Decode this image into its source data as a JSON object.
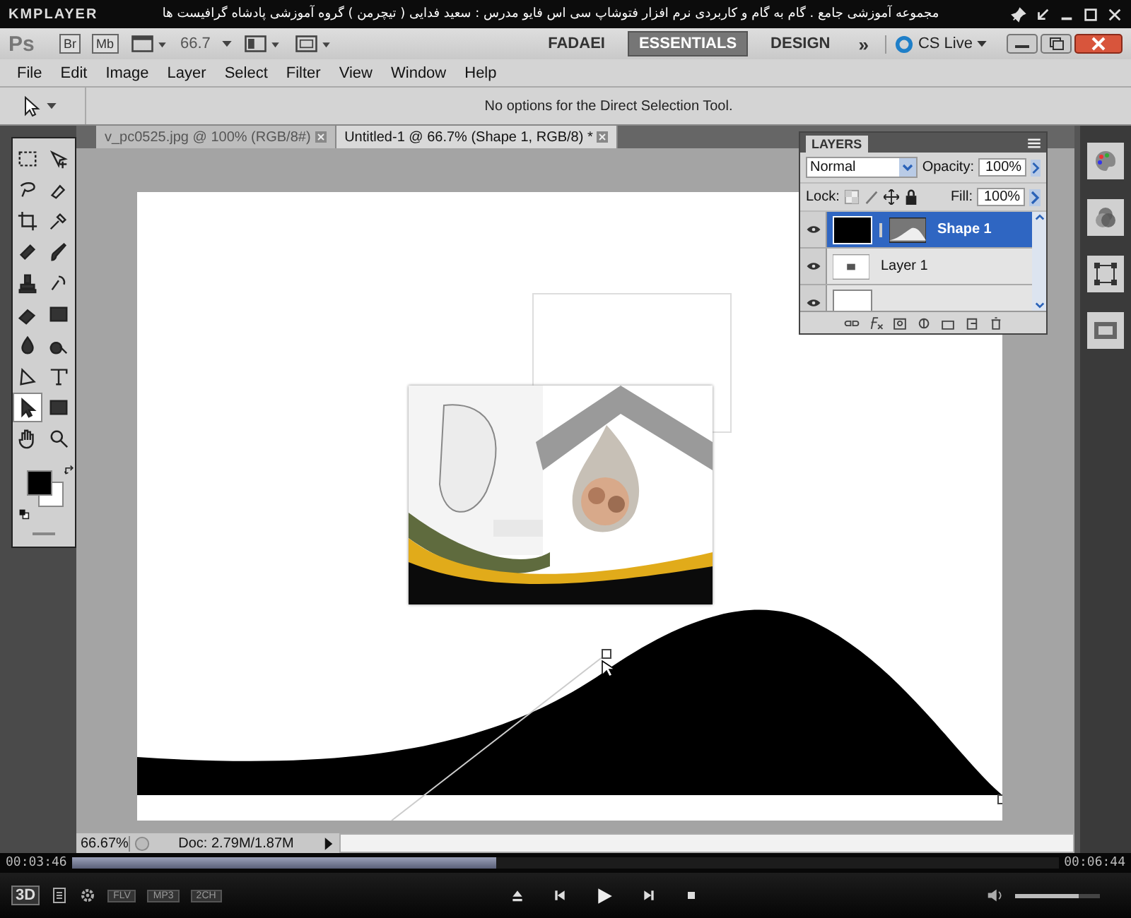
{
  "player": {
    "logo": "KMPLAYER",
    "title": "مجموعه آموزشی جامع . گام به گام و کاربردی نرم افزار فتوشاپ سی اس فایو  مدرس : سعید فدایی ( تیچرمن ) گروه آموزشی پادشاه گرافیست ها"
  },
  "app_bar": {
    "logo": "Ps",
    "bridge": "Br",
    "mini_bridge": "Mb",
    "zoom": "66.7",
    "more": "»",
    "cs_live": "CS Live",
    "workspaces": [
      {
        "label": "FADAEI",
        "selected": false
      },
      {
        "label": "ESSENTIALS",
        "selected": true
      },
      {
        "label": "DESIGN",
        "selected": false
      }
    ]
  },
  "menu": [
    "File",
    "Edit",
    "Image",
    "Layer",
    "Select",
    "Filter",
    "View",
    "Window",
    "Help"
  ],
  "options_bar": {
    "message": "No options for the Direct Selection Tool."
  },
  "doc_tabs": [
    {
      "label": "v_pc0525.jpg @ 100% (RGB/8#)",
      "selected": false
    },
    {
      "label": "Untitled-1 @ 66.7% (Shape 1, RGB/8) *",
      "selected": true
    }
  ],
  "tools": [
    {
      "selected": false
    },
    {
      "selected": false
    },
    {
      "selected": false
    },
    {
      "selected": false
    },
    {
      "selected": false
    },
    {
      "selected": false
    },
    {
      "selected": false
    },
    {
      "selected": false
    },
    {
      "selected": false
    },
    {
      "selected": false
    },
    {
      "selected": false
    },
    {
      "selected": false
    },
    {
      "selected": false
    },
    {
      "selected": false
    },
    {
      "selected": false
    },
    {
      "selected": false
    },
    {
      "selected": true
    },
    {
      "selected": false
    },
    {
      "selected": false
    },
    {
      "selected": false
    }
  ],
  "layers_panel": {
    "title": "LAYERS",
    "blend_mode": "Normal",
    "opacity_label": "Opacity:",
    "opacity": "100%",
    "lock_label": "Lock:",
    "fill_label": "Fill:",
    "fill": "100%",
    "layers": [
      {
        "kind": "shape",
        "name": "Shape 1",
        "selected": true,
        "visible": true
      },
      {
        "kind": "pixel",
        "name": "Layer 1",
        "selected": false,
        "visible": true
      },
      {
        "kind": "background",
        "selected": false,
        "visible": true
      }
    ]
  },
  "status_bar": {
    "zoom": "66.67%",
    "doc": "Doc: 2.79M/1.87M"
  },
  "playback": {
    "elapsed": "00:03:46",
    "total": "00:06:44",
    "level": 0.43,
    "three_d": "3D",
    "badges": [
      "FLV",
      "MP3",
      "2CH"
    ],
    "volume": {
      "level": 0.75
    }
  }
}
